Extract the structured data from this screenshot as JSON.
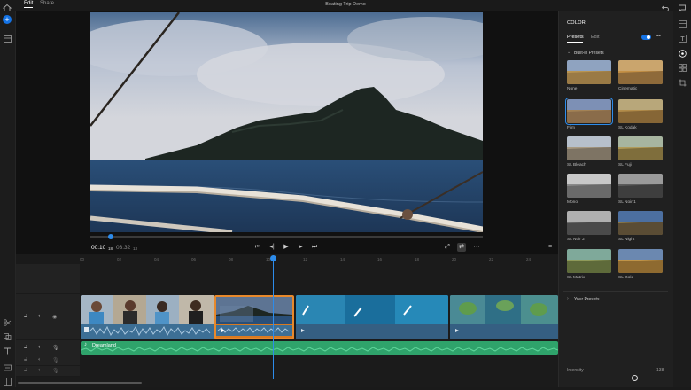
{
  "topbar": {
    "tabs": [
      {
        "label": "Edit"
      },
      {
        "label": "Share"
      }
    ],
    "title": "Boating Trip Demo"
  },
  "viewer": {
    "current_time": "00:10",
    "current_frames": "18",
    "duration": "03:32",
    "duration_frames": "13"
  },
  "ruler": {
    "ticks": [
      "00",
      "02",
      "04",
      "06",
      "08",
      "10",
      "12",
      "14",
      "16",
      "18",
      "20",
      "22",
      "24"
    ]
  },
  "audio": {
    "music_track_name": "Dreamland"
  },
  "panel": {
    "title": "COLOR",
    "tabs": [
      {
        "label": "Presets"
      },
      {
        "label": "Edit"
      }
    ],
    "more": "•••",
    "builtin_section": "Built-in Presets",
    "your_presets_section": "Your Presets",
    "presets": [
      {
        "label": "None"
      },
      {
        "label": "Cinematic"
      },
      {
        "label": "Film"
      },
      {
        "label": "SL Kodak"
      },
      {
        "label": "SL Bleach"
      },
      {
        "label": "SL Fuji"
      },
      {
        "label": "Mono"
      },
      {
        "label": "SL Noir 1"
      },
      {
        "label": "SL Noir 2"
      },
      {
        "label": "SL Night"
      },
      {
        "label": "SL Matrix"
      },
      {
        "label": "SL Gold"
      }
    ],
    "selected_preset": "Film",
    "intensity_label": "Intensity",
    "intensity_value": "138"
  },
  "colors": {
    "accent": "#2d8ceb",
    "clip_selected": "#e8892b",
    "audio_green": "#2fa36b",
    "video_clip_blue": "#3d6f95"
  }
}
